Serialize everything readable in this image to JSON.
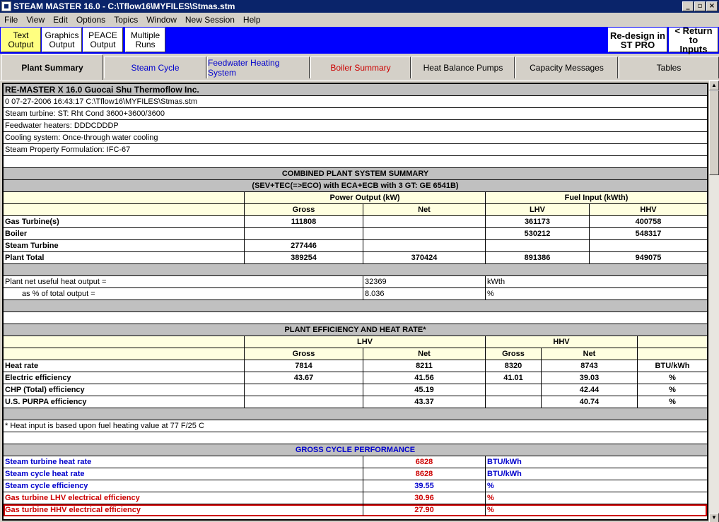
{
  "window": {
    "title": "STEAM MASTER 16.0 - C:\\Tflow16\\MYFILES\\Stmas.stm",
    "buttons": [
      "_",
      "▫",
      "×"
    ]
  },
  "menu": [
    "File",
    "View",
    "Edit",
    "Options",
    "Topics",
    "Window",
    "New Session",
    "Help"
  ],
  "toolbar": {
    "text_output": "Text\nOutput",
    "graphics_output": "Graphics\nOutput",
    "peace_output": "PEACE\nOutput",
    "multiple_runs": "Multiple\nRuns",
    "redesign": "Re-design in\nST PRO",
    "return_inputs": "< Return to\nInputs"
  },
  "tabs": [
    "Plant Summary",
    "Steam Cycle",
    "Feedwater Heating System",
    "Boiler Summary",
    "Heat Balance Pumps",
    "Capacity Messages",
    "Tables"
  ],
  "colors": {
    "accent": "#0000ff",
    "title_bar": "#0a246a",
    "highlight": "#cc0000",
    "link_blue": "#0000cc"
  },
  "header": {
    "line1": "RE-MASTER X 16.0  Guocai Shu  Thermoflow Inc.",
    "line2": "0 07-27-2006 16:43:17  C:\\Tflow16\\MYFILES\\Stmas.stm",
    "line3": "Steam turbine: ST: Rht Cond 3600+3600/3600",
    "line4": "Feedwater heaters: DDDCDDDP",
    "line5": "Cooling system: Once-through water cooling",
    "line6": "Steam Property Formulation: IFC-67"
  },
  "combined": {
    "title": "COMBINED PLANT SYSTEM SUMMARY",
    "subtitle": "(SEV+TEC(=>ECO) with ECA+ECB with 3 GT: GE 6541B)",
    "power_output": "Power Output (kW)",
    "fuel_input": "Fuel Input (kWth)",
    "gross": "Gross",
    "net": "Net",
    "lhv": "LHV",
    "hhv": "HHV",
    "rows": [
      {
        "label": "Gas Turbine(s)",
        "gross": "111808",
        "net": "",
        "lhv": "361173",
        "hhv": "400758"
      },
      {
        "label": "Boiler",
        "gross": "",
        "net": "",
        "lhv": "530212",
        "hhv": "548317"
      },
      {
        "label": "Steam Turbine",
        "gross": "277446",
        "net": "",
        "lhv": "",
        "hhv": ""
      },
      {
        "label": "Plant Total",
        "gross": "389254",
        "net": "370424",
        "lhv": "891386",
        "hhv": "949075"
      }
    ],
    "heat_output_label": "Plant net useful heat output =",
    "heat_output_value": "32369",
    "heat_output_unit": "kWth",
    "pct_label": "as % of total output =",
    "pct_value": "8.036",
    "pct_unit": "%"
  },
  "efficiency": {
    "title": "PLANT EFFICIENCY AND HEAT RATE*",
    "lhv": "LHV",
    "hhv": "HHV",
    "gross": "Gross",
    "net": "Net",
    "rows": [
      {
        "label": "Heat rate",
        "lhv_gross": "7814",
        "lhv_net": "8211",
        "hhv_gross": "8320",
        "hhv_net": "8743",
        "unit": "BTU/kWh"
      },
      {
        "label": "Electric efficiency",
        "lhv_gross": "43.67",
        "lhv_net": "41.56",
        "hhv_gross": "41.01",
        "hhv_net": "39.03",
        "unit": "%"
      },
      {
        "label": "CHP (Total) efficiency",
        "lhv_gross": "",
        "lhv_net": "45.19",
        "hhv_gross": "",
        "hhv_net": "42.44",
        "unit": "%"
      },
      {
        "label": "U.S. PURPA efficiency",
        "lhv_gross": "",
        "lhv_net": "43.37",
        "hhv_gross": "",
        "hhv_net": "40.74",
        "unit": "%"
      }
    ],
    "footnote": "* Heat input is based upon fuel heating value at 77 F/25 C"
  },
  "gross_cycle": {
    "title": "GROSS CYCLE PERFORMANCE",
    "rows": [
      {
        "label": "Steam turbine heat rate",
        "value": "6828",
        "unit": "BTU/kWh",
        "color": "blue"
      },
      {
        "label": "Steam cycle heat rate",
        "value": "8628",
        "unit": "BTU/kWh",
        "color": "blue"
      },
      {
        "label": "Steam cycle efficiency",
        "value": "39.55",
        "unit": "%",
        "color": "blue"
      },
      {
        "label": "Gas turbine LHV electrical efficiency",
        "value": "30.96",
        "unit": "%",
        "color": "red"
      },
      {
        "label": "Gas turbine HHV electrical efficiency",
        "value": "27.90",
        "unit": "%",
        "color": "red"
      }
    ]
  }
}
